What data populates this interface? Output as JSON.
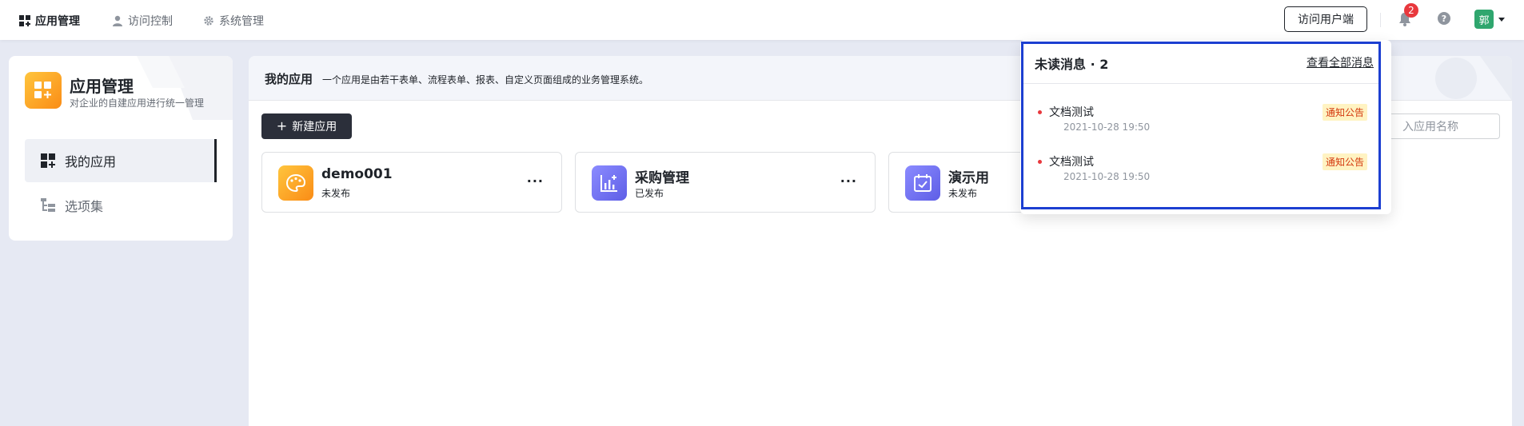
{
  "nav": {
    "items": [
      {
        "label": "应用管理",
        "icon": "grid-icon",
        "active": true
      },
      {
        "label": "访问控制",
        "icon": "user-icon",
        "active": false
      },
      {
        "label": "系统管理",
        "icon": "gear-icon",
        "active": false
      }
    ],
    "visit_button": "访问用户端",
    "notification_count": "2",
    "avatar_text": "郭"
  },
  "sidebar": {
    "title": "应用管理",
    "subtitle": "对企业的自建应用进行统一管理",
    "items": [
      {
        "label": "我的应用",
        "active": true
      },
      {
        "label": "选项集",
        "active": false
      }
    ]
  },
  "main": {
    "title": "我的应用",
    "description": "一个应用是由若干表单、流程表单、报表、自定义页面组成的业务管理系统。",
    "new_button": "新建应用",
    "search_placeholder": "入应用名称",
    "apps": [
      {
        "name": "demo001",
        "status": "未发布",
        "color": "#fa8c16"
      },
      {
        "name": "采购管理",
        "status": "已发布",
        "color": "#6f6ff2"
      },
      {
        "name": "演示用",
        "status": "未发布",
        "color": "#6f6ff2"
      }
    ],
    "more_label": "···"
  },
  "popover": {
    "title": "未读消息 · 2",
    "view_all": "查看全部消息",
    "messages": [
      {
        "title": "文档测试",
        "time": "2021-10-28 19:50",
        "tag": "通知公告"
      },
      {
        "title": "文档测试",
        "time": "2021-10-28 19:50",
        "tag": "通知公告"
      }
    ]
  }
}
